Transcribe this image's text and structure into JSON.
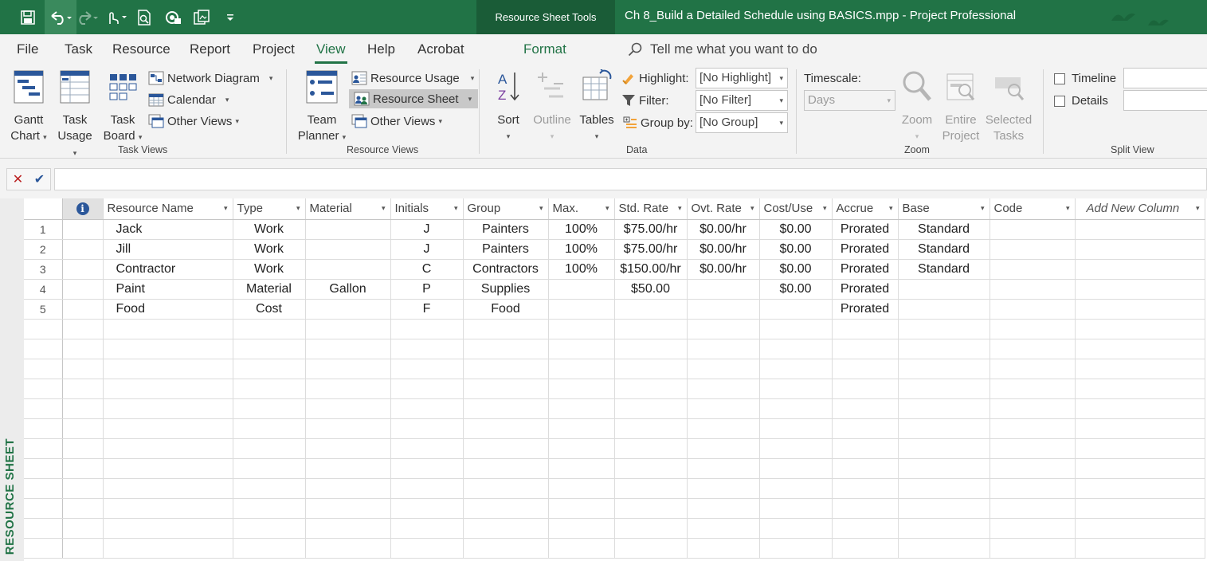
{
  "titlebar": {
    "context_tab": "Resource Sheet Tools",
    "doc_title": "Ch 8_Build a Detailed Schedule using BASICS.mpp  -  Project Professional"
  },
  "tabs": [
    "File",
    "Task",
    "Resource",
    "Report",
    "Project",
    "View",
    "Help",
    "Acrobat"
  ],
  "format_tab": "Format",
  "tell_me": "Tell me what you want to do",
  "ribbon": {
    "task_views": {
      "label": "Task Views",
      "gantt": [
        "Gantt",
        "Chart"
      ],
      "task_usage": [
        "Task",
        "Usage"
      ],
      "task_board": [
        "Task",
        "Board"
      ],
      "network_diagram": "Network Diagram",
      "calendar": "Calendar",
      "other_views": "Other Views"
    },
    "resource_views": {
      "label": "Resource Views",
      "team_planner": [
        "Team",
        "Planner"
      ],
      "resource_usage": "Resource Usage",
      "resource_sheet": "Resource Sheet",
      "other_views": "Other Views"
    },
    "data": {
      "label": "Data",
      "sort": "Sort",
      "outline": "Outline",
      "tables": "Tables",
      "highlight_label": "Highlight:",
      "highlight_value": "[No Highlight]",
      "filter_label": "Filter:",
      "filter_value": "[No Filter]",
      "groupby_label": "Group by:",
      "groupby_value": "[No Group]"
    },
    "zoom": {
      "label": "Zoom",
      "timescale_label": "Timescale:",
      "timescale_value": "Days",
      "zoom": "Zoom",
      "entire_project": [
        "Entire",
        "Project"
      ],
      "selected_tasks": [
        "Selected",
        "Tasks"
      ]
    },
    "split_view": {
      "label": "Split View",
      "timeline": "Timeline",
      "details": "Details"
    }
  },
  "view_bar_label": "RESOURCE SHEET",
  "grid": {
    "columns": [
      "Resource Name",
      "Type",
      "Material",
      "Initials",
      "Group",
      "Max.",
      "Std. Rate",
      "Ovt. Rate",
      "Cost/Use",
      "Accrue",
      "Base",
      "Code",
      "Add New Column"
    ],
    "rows": [
      {
        "id": "1",
        "name": "Jack",
        "type": "Work",
        "material": "",
        "initials": "J",
        "group": "Painters",
        "max": "100%",
        "std_rate": "$75.00/hr",
        "ovt_rate": "$0.00/hr",
        "cost_use": "$0.00",
        "accrue": "Prorated",
        "base": "Standard",
        "code": ""
      },
      {
        "id": "2",
        "name": "Jill",
        "type": "Work",
        "material": "",
        "initials": "J",
        "group": "Painters",
        "max": "100%",
        "std_rate": "$75.00/hr",
        "ovt_rate": "$0.00/hr",
        "cost_use": "$0.00",
        "accrue": "Prorated",
        "base": "Standard",
        "code": ""
      },
      {
        "id": "3",
        "name": "Contractor",
        "type": "Work",
        "material": "",
        "initials": "C",
        "group": "Contractors",
        "max": "100%",
        "std_rate": "$150.00/hr",
        "ovt_rate": "$0.00/hr",
        "cost_use": "$0.00",
        "accrue": "Prorated",
        "base": "Standard",
        "code": ""
      },
      {
        "id": "4",
        "name": "Paint",
        "type": "Material",
        "material": "Gallon",
        "initials": "P",
        "group": "Supplies",
        "max": "",
        "std_rate": "$50.00",
        "ovt_rate": "",
        "cost_use": "$0.00",
        "accrue": "Prorated",
        "base": "",
        "code": ""
      },
      {
        "id": "5",
        "name": "Food",
        "type": "Cost",
        "material": "",
        "initials": "F",
        "group": "Food",
        "max": "",
        "std_rate": "",
        "ovt_rate": "",
        "cost_use": "",
        "accrue": "Prorated",
        "base": "",
        "code": ""
      }
    ],
    "empty_rows": 12
  },
  "colors": {
    "brand": "#217346",
    "context_tab": "#1a5c37"
  }
}
